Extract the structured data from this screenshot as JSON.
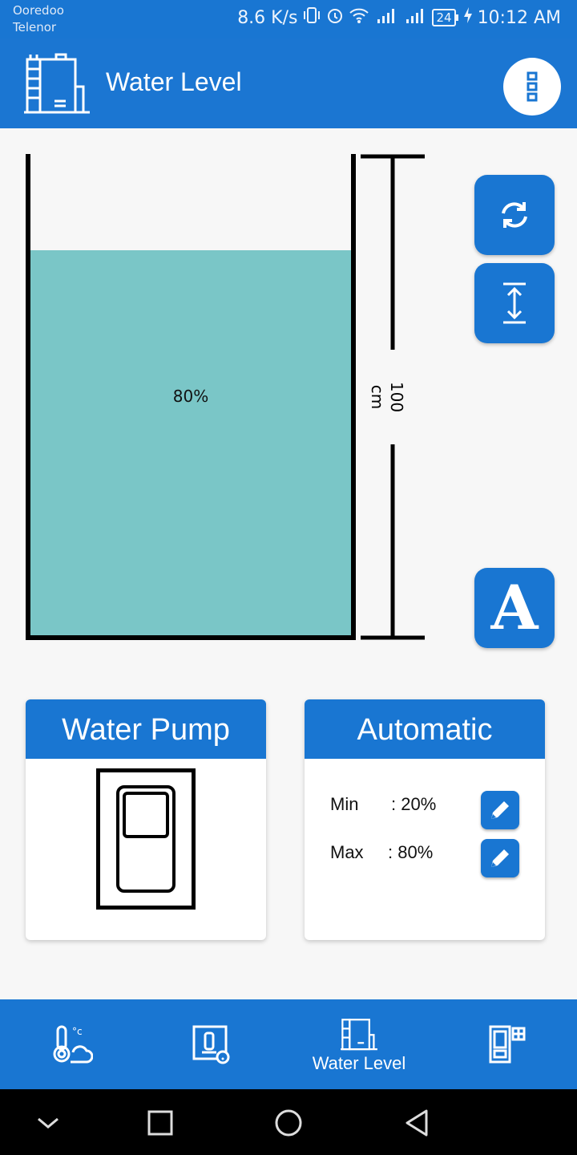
{
  "status_bar": {
    "carrier1": "Ooredoo",
    "carrier2": "Telenor",
    "speed": "8.6 K/s",
    "battery": "24",
    "time": "10:12 AM"
  },
  "app_bar": {
    "title": "Water Level"
  },
  "tank": {
    "level_percent": 80,
    "level_label": "80%",
    "height_label": "100 cm",
    "water_color": "#7ac6c7"
  },
  "buttons": {
    "auto_label": "A"
  },
  "pump_card": {
    "title": "Water Pump"
  },
  "auto_card": {
    "title": "Automatic",
    "min_label": "Min",
    "min_value": ": 20%",
    "max_label": "Max",
    "max_value": ": 80%"
  },
  "bottom_nav": {
    "items": [
      {
        "icon": "thermometer-cloud-icon",
        "label": ""
      },
      {
        "icon": "wifi-switch-icon",
        "label": ""
      },
      {
        "icon": "water-tank-icon",
        "label": "Water Level",
        "active": true
      },
      {
        "icon": "switch-panel-icon",
        "label": ""
      }
    ]
  },
  "colors": {
    "primary": "#1976d2",
    "water": "#7ac6c7"
  }
}
